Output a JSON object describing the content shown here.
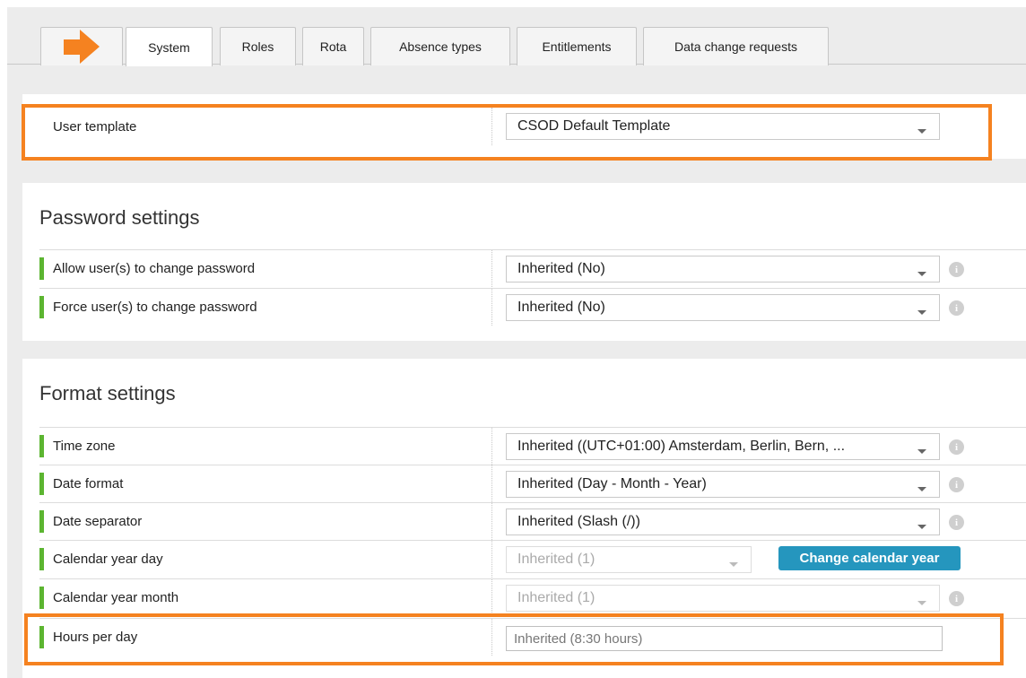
{
  "tabs": [
    {
      "label": "System",
      "active": true
    },
    {
      "label": "Roles",
      "active": false
    },
    {
      "label": "Rota",
      "active": false
    },
    {
      "label": "Absence types",
      "active": false
    },
    {
      "label": "Entitlements",
      "active": false
    },
    {
      "label": "Data change requests",
      "active": false
    }
  ],
  "user_template": {
    "label": "User template",
    "value": "CSOD Default Template"
  },
  "password_settings": {
    "title": "Password settings",
    "rows": [
      {
        "label": "Allow user(s) to change password",
        "value": "Inherited (No)"
      },
      {
        "label": "Force user(s) to change password",
        "value": "Inherited (No)"
      }
    ]
  },
  "format_settings": {
    "title": "Format settings",
    "rows": [
      {
        "label": "Time zone",
        "value": "Inherited ((UTC+01:00) Amsterdam, Berlin, Bern, ..."
      },
      {
        "label": "Date format",
        "value": "Inherited (Day - Month - Year)"
      },
      {
        "label": "Date separator",
        "value": "Inherited (Slash (/))"
      },
      {
        "label": "Calendar year day",
        "value": "Inherited (1)",
        "button": "Change calendar year"
      },
      {
        "label": "Calendar year month",
        "value": "Inherited (1)"
      },
      {
        "label": "Hours per day",
        "value": "Inherited (8:30 hours)"
      }
    ]
  },
  "icons": {
    "info": "info-icon",
    "dropdown": "chevron-down-icon",
    "arrow": "right-arrow-icon"
  },
  "colors": {
    "accent_orange": "#f58220",
    "status_green": "#5cb531",
    "button_blue": "#2596be"
  }
}
